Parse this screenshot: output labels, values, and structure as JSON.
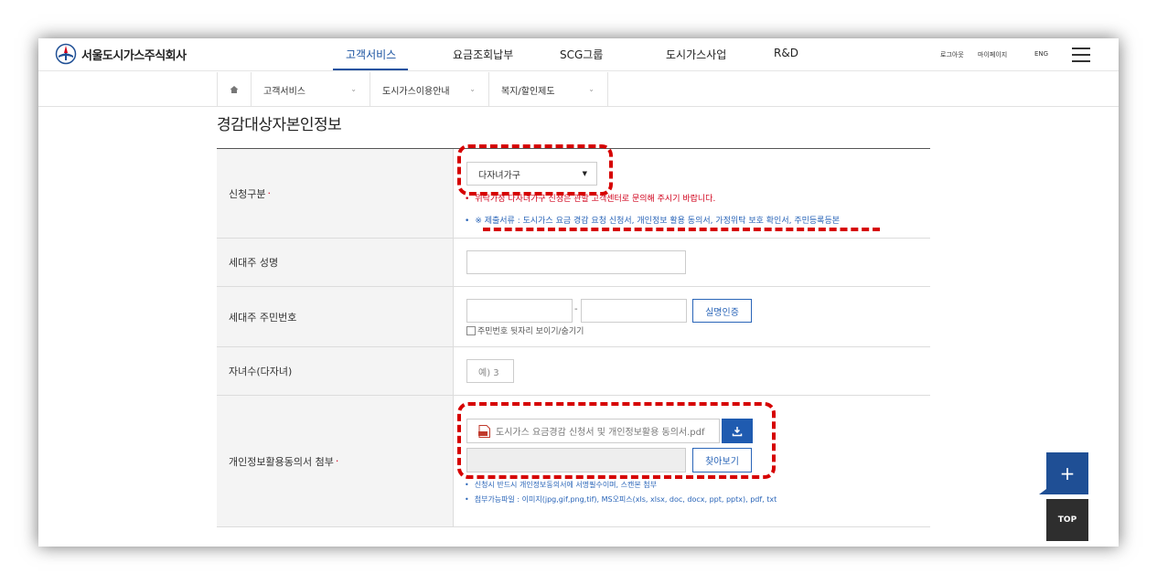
{
  "brand": {
    "name": "서울도시가스주식회사"
  },
  "gnb": {
    "items": [
      "고객서비스",
      "요금조회납부",
      "SCG그룹",
      "도시가스사업",
      "R&D"
    ],
    "active_index": 0
  },
  "util": {
    "login": "로그아웃",
    "mypage": "마이페이지",
    "lang": "ENG"
  },
  "subnav": {
    "items": [
      "고객서비스",
      "도시가스이용안내",
      "복지/할인제도"
    ]
  },
  "section_title": "경감대상자본인정보",
  "form": {
    "apply_type": {
      "label": "신청구분",
      "selected": "다자녀가구",
      "note_red": "위탁가정 다자녀가구 신청은 관할 고객센터로 문의해 주시기 바랍니다.",
      "note_blue": "※ 제출서류 : 도시가스 요금 경감 요청 신청서, 개인정보 활용 동의서, 가정위탁 보호 확인서, 주민등록등본"
    },
    "head_name": {
      "label": "세대주 성명",
      "value": ""
    },
    "head_rrn": {
      "label": "세대주 주민번호",
      "verify_button": "실명인증",
      "toggle_label": "주민번호 뒷자리 보이기/숨기기"
    },
    "children": {
      "label": "자녀수(다자녀)",
      "placeholder": "예) 3"
    },
    "attachment": {
      "label": "개인정보활용동의서 첨부",
      "template_file": "도시가스 요금경감 신청서 및 개인정보활용 동의서.pdf",
      "browse_button": "찾아보기",
      "note1": "신청시 반드시 개인정보동의서에 서명필수이며, 스캔본 첨부",
      "note2": "첨부가능파일 : 이미지(jpg,gif,png,tif), MS오피스(xls, xlsx, doc, docx, ppt, pptx), pdf, txt"
    }
  },
  "floating": {
    "plus": "+",
    "top": "TOP"
  },
  "colors": {
    "accent": "#1f5bb0",
    "required": "#d0011b",
    "annotation": "#d60000"
  }
}
